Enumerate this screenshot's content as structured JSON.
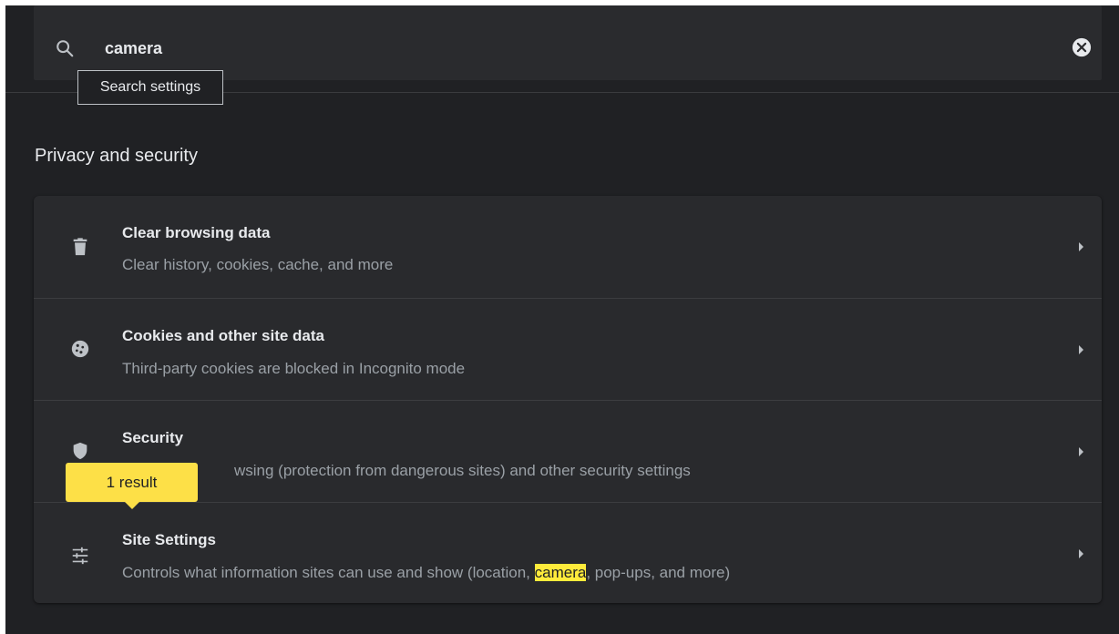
{
  "search": {
    "value": "camera",
    "tooltip": "Search settings"
  },
  "section": {
    "title": "Privacy and security"
  },
  "rows": [
    {
      "title": "Clear browsing data",
      "subtitle": "Clear history, cookies, cache, and more",
      "icon": "trash-icon"
    },
    {
      "title": "Cookies and other site data",
      "subtitle": "Third-party cookies are blocked in Incognito mode",
      "icon": "cookie-icon"
    },
    {
      "title": "Security",
      "subtitle_visible": "wsing (protection from dangerous sites) and other security settings",
      "icon": "shield-icon"
    },
    {
      "title": "Site Settings",
      "subtitle_before": "Controls what information sites can use and show (location, ",
      "subtitle_highlight": "camera",
      "subtitle_after": ", pop-ups, and more)",
      "icon": "sliders-icon"
    }
  ],
  "result_bubble": {
    "label": "1 result"
  },
  "colors": {
    "background": "#202124",
    "card": "#292a2d",
    "highlight": "#ffeb3b",
    "bubble": "#fde047",
    "text_primary": "#e8eaed",
    "text_secondary": "#9aa0a6"
  }
}
